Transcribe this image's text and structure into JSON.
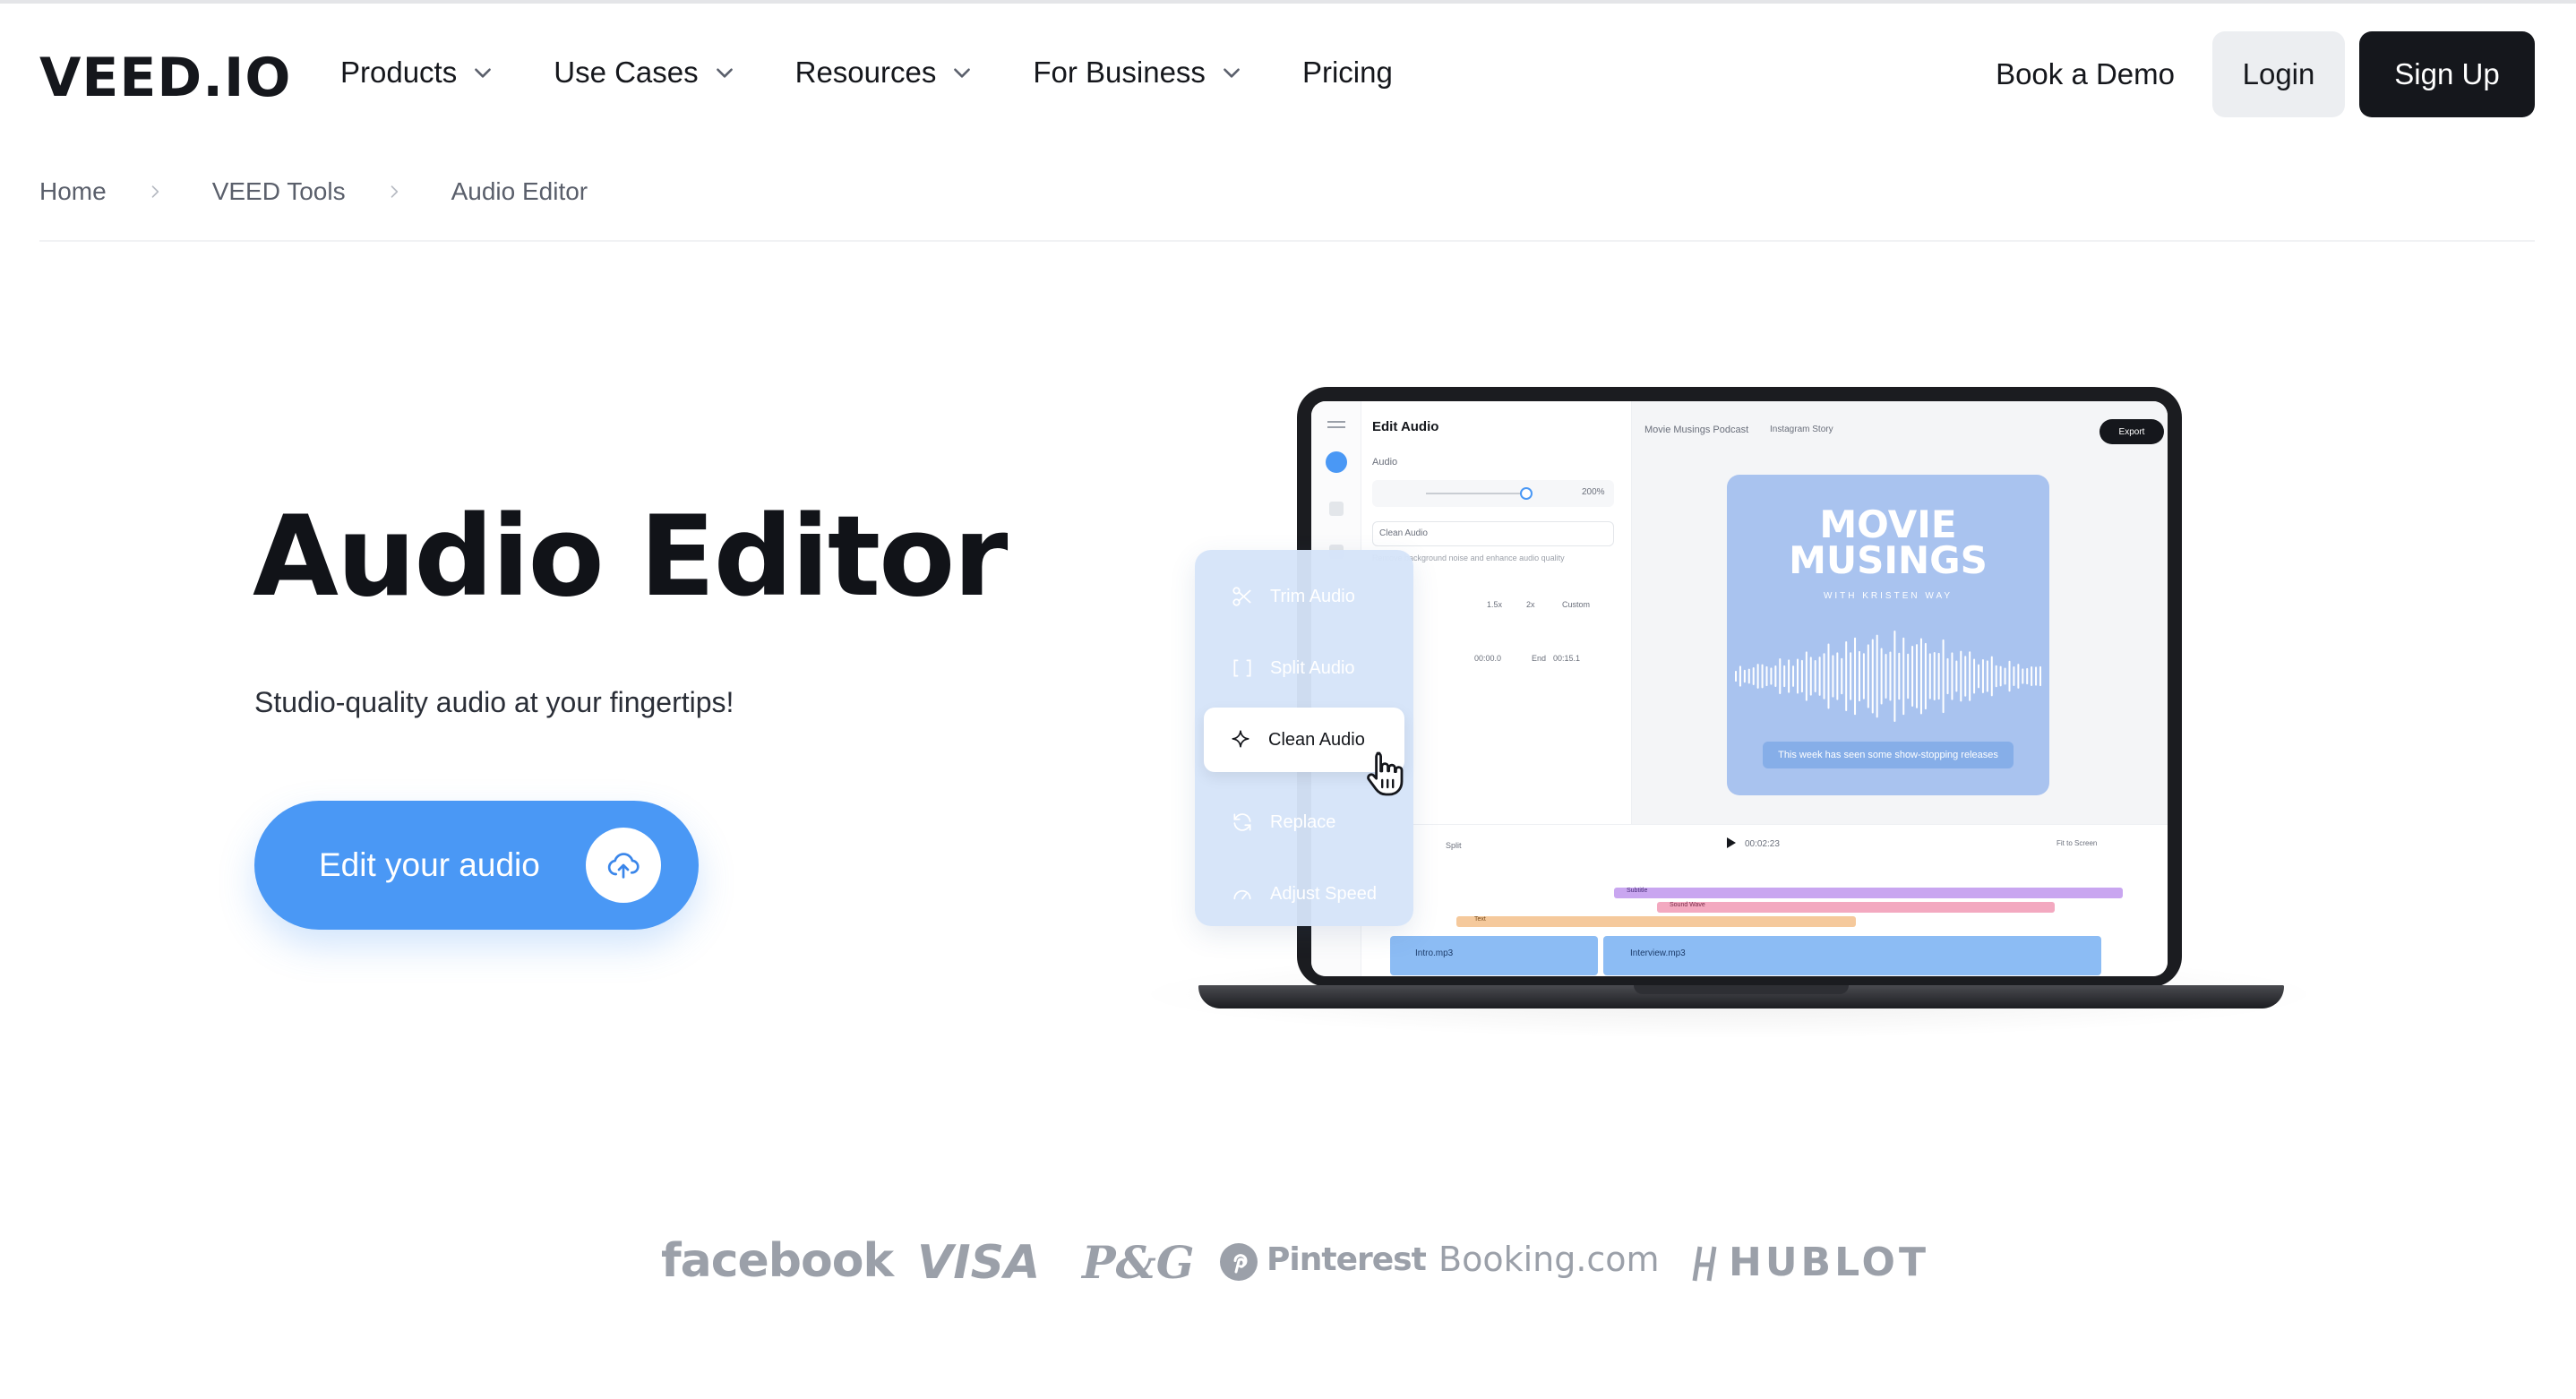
{
  "brand": {
    "name": "VEED.IO"
  },
  "nav": {
    "items": [
      {
        "label": "Products",
        "has_dropdown": true
      },
      {
        "label": "Use Cases",
        "has_dropdown": true
      },
      {
        "label": "Resources",
        "has_dropdown": true
      },
      {
        "label": "For Business",
        "has_dropdown": true
      },
      {
        "label": "Pricing",
        "has_dropdown": false
      }
    ],
    "book_demo": "Book a Demo",
    "login": "Login",
    "signup": "Sign Up"
  },
  "breadcrumb": [
    "Home",
    "VEED Tools",
    "Audio Editor"
  ],
  "hero": {
    "title": "Audio Editor",
    "subtitle": "Studio-quality audio at your fingertips!",
    "cta_label": "Edit your audio",
    "cta_icon": "upload-cloud-icon"
  },
  "mockup": {
    "panel_title": "Edit Audio",
    "panel_section": "Audio",
    "volume_value": "200%",
    "clean_audio_field": "Clean Audio",
    "clean_audio_hint": "Remove background noise and enhance audio quality",
    "speed_options": [
      "1.5x",
      "2x",
      "Custom"
    ],
    "start_time": "00:00.0",
    "end_label": "End",
    "end_time": "00:15.1",
    "project_name": "Movie Musings Podcast",
    "format_label": "Instagram Story",
    "export_label": "Export",
    "preview_title_line1": "MOVIE",
    "preview_title_line2": "MUSINGS",
    "preview_byline": "WITH KRISTEN WAY",
    "preview_caption": "This week has seen some show-stopping releases",
    "timecode": "00:02:23",
    "fit_label": "Fit to Screen",
    "split_label": "Split",
    "track_subtitle": "Subtitle",
    "track_sound": "Sound Wave",
    "track_text": "Text",
    "clip_intro": "Intro.mp3",
    "clip_interview": "Interview.mp3"
  },
  "tool_menu": {
    "items": [
      {
        "label": "Trim Audio",
        "icon": "scissors-icon"
      },
      {
        "label": "Split Audio",
        "icon": "split-brackets-icon"
      },
      {
        "label": "Clean Audio",
        "icon": "sparkle-icon",
        "active": true
      },
      {
        "label": "Replace",
        "icon": "refresh-icon"
      },
      {
        "label": "Adjust Speed",
        "icon": "speedometer-icon"
      }
    ]
  },
  "client_logos": [
    "facebook",
    "VISA",
    "P&G",
    "Pinterest",
    "Booking.com",
    "HUBLOT"
  ],
  "colors": {
    "primary_blue": "#4a98f5",
    "dark": "#15171c",
    "login_bg": "#eceef1",
    "logo_gray": "#9ba0a9",
    "preview_card": "#a9c3ef"
  }
}
